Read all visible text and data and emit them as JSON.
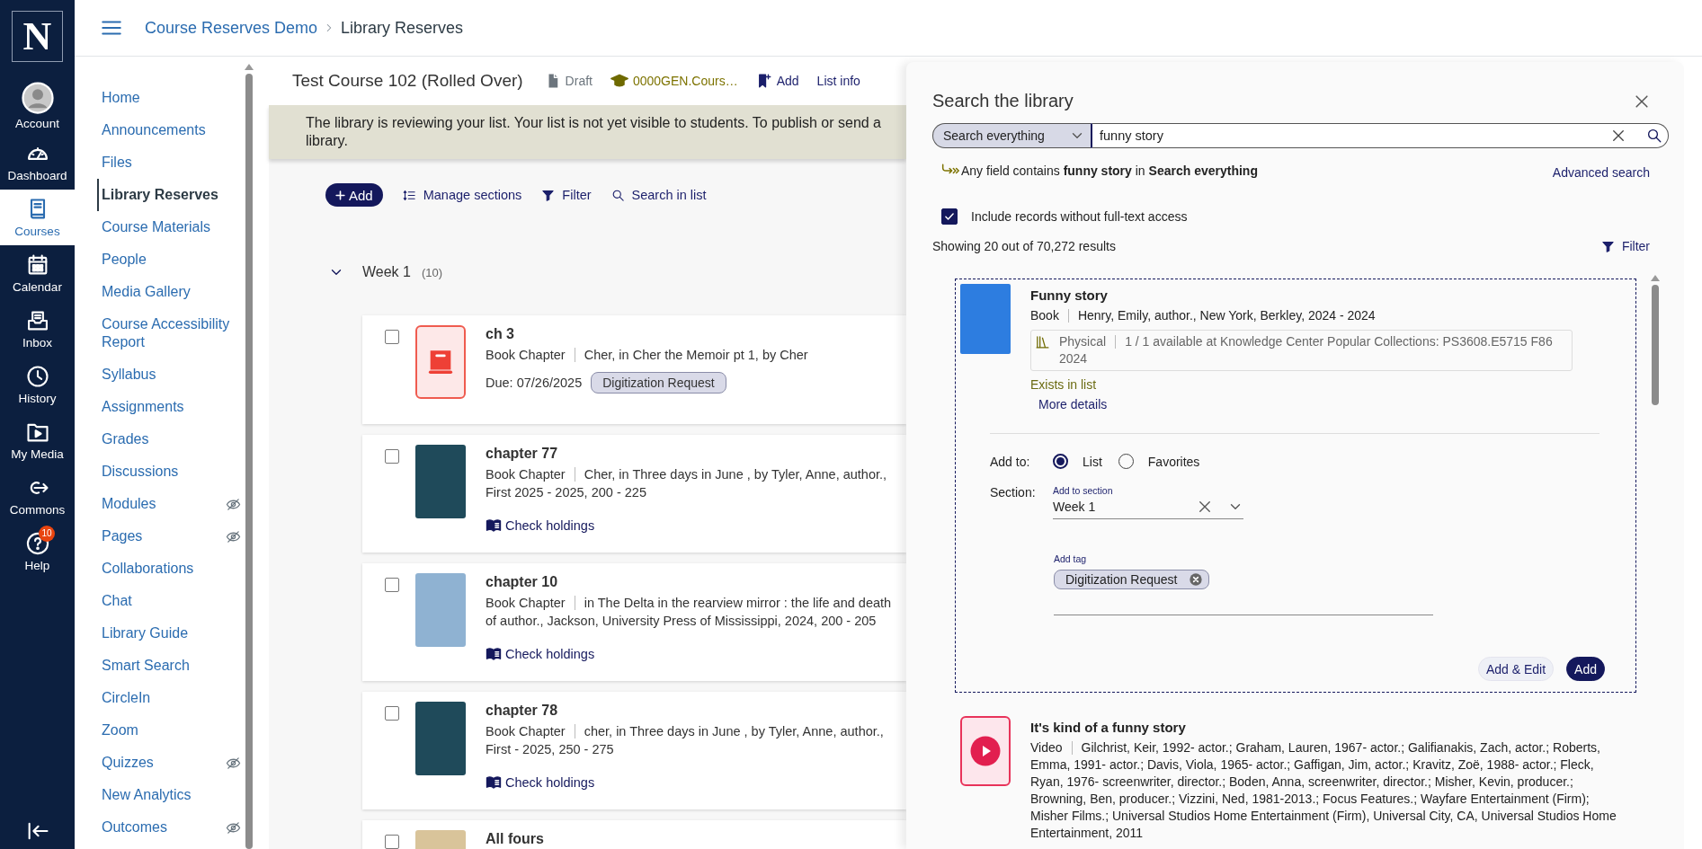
{
  "global_nav": {
    "logo": "N",
    "items": [
      {
        "label": "Account",
        "selected": false
      },
      {
        "label": "Dashboard",
        "selected": false
      },
      {
        "label": "Courses",
        "selected": true
      },
      {
        "label": "Calendar",
        "selected": false
      },
      {
        "label": "Inbox",
        "selected": false
      },
      {
        "label": "History",
        "selected": false
      },
      {
        "label": "My Media",
        "selected": false
      },
      {
        "label": "Commons",
        "selected": false
      },
      {
        "label": "Help",
        "selected": false,
        "badge": "10"
      }
    ]
  },
  "breadcrumb": [
    "Course Reserves Demo",
    "Library Reserves"
  ],
  "course_nav": {
    "items": [
      {
        "label": "Home",
        "selected": false,
        "hidden": false
      },
      {
        "label": "Announcements",
        "selected": false,
        "hidden": false
      },
      {
        "label": "Files",
        "selected": false,
        "hidden": false
      },
      {
        "label": "Library Reserves",
        "selected": true,
        "hidden": false
      },
      {
        "label": "Course Materials",
        "selected": false,
        "hidden": false
      },
      {
        "label": "People",
        "selected": false,
        "hidden": false
      },
      {
        "label": "Media Gallery",
        "selected": false,
        "hidden": false
      },
      {
        "label": "Course Accessibility Report",
        "selected": false,
        "hidden": false
      },
      {
        "label": "Syllabus",
        "selected": false,
        "hidden": false
      },
      {
        "label": "Assignments",
        "selected": false,
        "hidden": false
      },
      {
        "label": "Grades",
        "selected": false,
        "hidden": false
      },
      {
        "label": "Discussions",
        "selected": false,
        "hidden": false
      },
      {
        "label": "Modules",
        "selected": false,
        "hidden": true
      },
      {
        "label": "Pages",
        "selected": false,
        "hidden": true
      },
      {
        "label": "Collaborations",
        "selected": false,
        "hidden": false
      },
      {
        "label": "Chat",
        "selected": false,
        "hidden": false
      },
      {
        "label": "Library Guide",
        "selected": false,
        "hidden": false
      },
      {
        "label": "Smart Search",
        "selected": false,
        "hidden": false
      },
      {
        "label": "CircleIn",
        "selected": false,
        "hidden": false
      },
      {
        "label": "Zoom",
        "selected": false,
        "hidden": false
      },
      {
        "label": "Quizzes",
        "selected": false,
        "hidden": true
      },
      {
        "label": "New Analytics",
        "selected": false,
        "hidden": false
      },
      {
        "label": "Outcomes",
        "selected": false,
        "hidden": true
      }
    ]
  },
  "list": {
    "title": "Test Course 102 (Rolled Over)",
    "status": "Draft",
    "course_code": "0000GEN.Cours…",
    "add": "Add",
    "info": "List info",
    "banner": "The library is reviewing your list. Your list is not yet visible to students. To publish or send a library.",
    "toolbar": [
      "Add",
      "Manage sections",
      "Filter",
      "Search in list"
    ],
    "section": {
      "name": "Week 1",
      "count": "(10)",
      "expanded": true
    },
    "items": [
      {
        "kind": "generic",
        "title": "ch 3",
        "type": "Book Chapter",
        "description": "Cher, in Cher the Memoir pt 1, by Cher",
        "due": "Due: 07/26/2025",
        "tag": "Digitization Request",
        "checked": false
      },
      {
        "kind": "cover",
        "title": "chapter 77",
        "type": "Book Chapter",
        "description": "Cher, in Three days in June , by Tyler, Anne, author., First 2025 - 2025, 200 - 225",
        "link": "Check holdings",
        "checked": false
      },
      {
        "kind": "cover",
        "title": "chapter 10",
        "type": "Book Chapter",
        "description": "in The Delta in the rearview mirror : the life and death of author., Jackson, University Press of Mississippi, 2024, 200 - 205",
        "link": "Check holdings",
        "checked": false
      },
      {
        "kind": "cover",
        "title": "chapter 78",
        "type": "Book Chapter",
        "description": "cher, in Three days in June , by Tyler, Anne, author., First - 2025, 250 - 275",
        "link": "Check holdings",
        "checked": false
      },
      {
        "kind": "cover",
        "title": "All fours",
        "checked": false
      }
    ]
  },
  "search_panel": {
    "title": "Search the library",
    "scope": "Search everything",
    "query": "funny story",
    "summary": "Any field contains **funny story** in **Search everything**",
    "advanced": "Advanced search",
    "include_fulltext": {
      "label": "Include records without full-text access",
      "checked": true
    },
    "results_count": "Showing 20 out of 70,272 results",
    "filter": "Filter",
    "results": [
      {
        "kind": "book",
        "selected": true,
        "title": "Funny story",
        "type": "Book",
        "description": "Henry, Emily, author., New York, Berkley, 2024 - 2024",
        "availability": {
          "format": "Physical",
          "text": "1 / 1 available at Knowledge Center Popular Collections: PS3608.E5715 F86 2024"
        },
        "status": "Exists in list",
        "more": "More details",
        "add_form": {
          "add_to_label": "Add to:",
          "targets": [
            {
              "label": "List",
              "selected": true
            },
            {
              "label": "Favorites",
              "selected": false
            }
          ],
          "section_label": "Section:",
          "section_field": {
            "label": "Add to section",
            "value": "Week 1"
          },
          "tag_field": {
            "label": "Add tag",
            "tags": [
              "Digitization Request"
            ]
          },
          "buttons": [
            {
              "label": "Add & Edit",
              "primary": false
            },
            {
              "label": "Add",
              "primary": true
            }
          ]
        }
      },
      {
        "kind": "video",
        "selected": false,
        "title": "It's kind of a funny story",
        "type": "Video",
        "description": "Gilchrist, Keir, 1992- actor.; Graham, Lauren, 1967- actor.; Galifianakis, Zach, actor.; Roberts, Emma, 1991- actor.; Davis, Viola, 1965- actor.; Gaffigan, Jim, actor.; Kravitz, Zoë, 1988- actor.; Fleck, Ryan, 1976- screenwriter, director.; Boden, Anna, screenwriter, director.; Misher, Kevin, producer.; Browning, Ben, producer.; Vizzini, Ned, 1981-2013.; Focus Features.; Wayfare Entertainment (Firm); Misher Films.; Universal Studios Home Entertainment (Firm), Universal City, CA, Universal Studios Home Entertainment, 2011"
      }
    ]
  }
}
